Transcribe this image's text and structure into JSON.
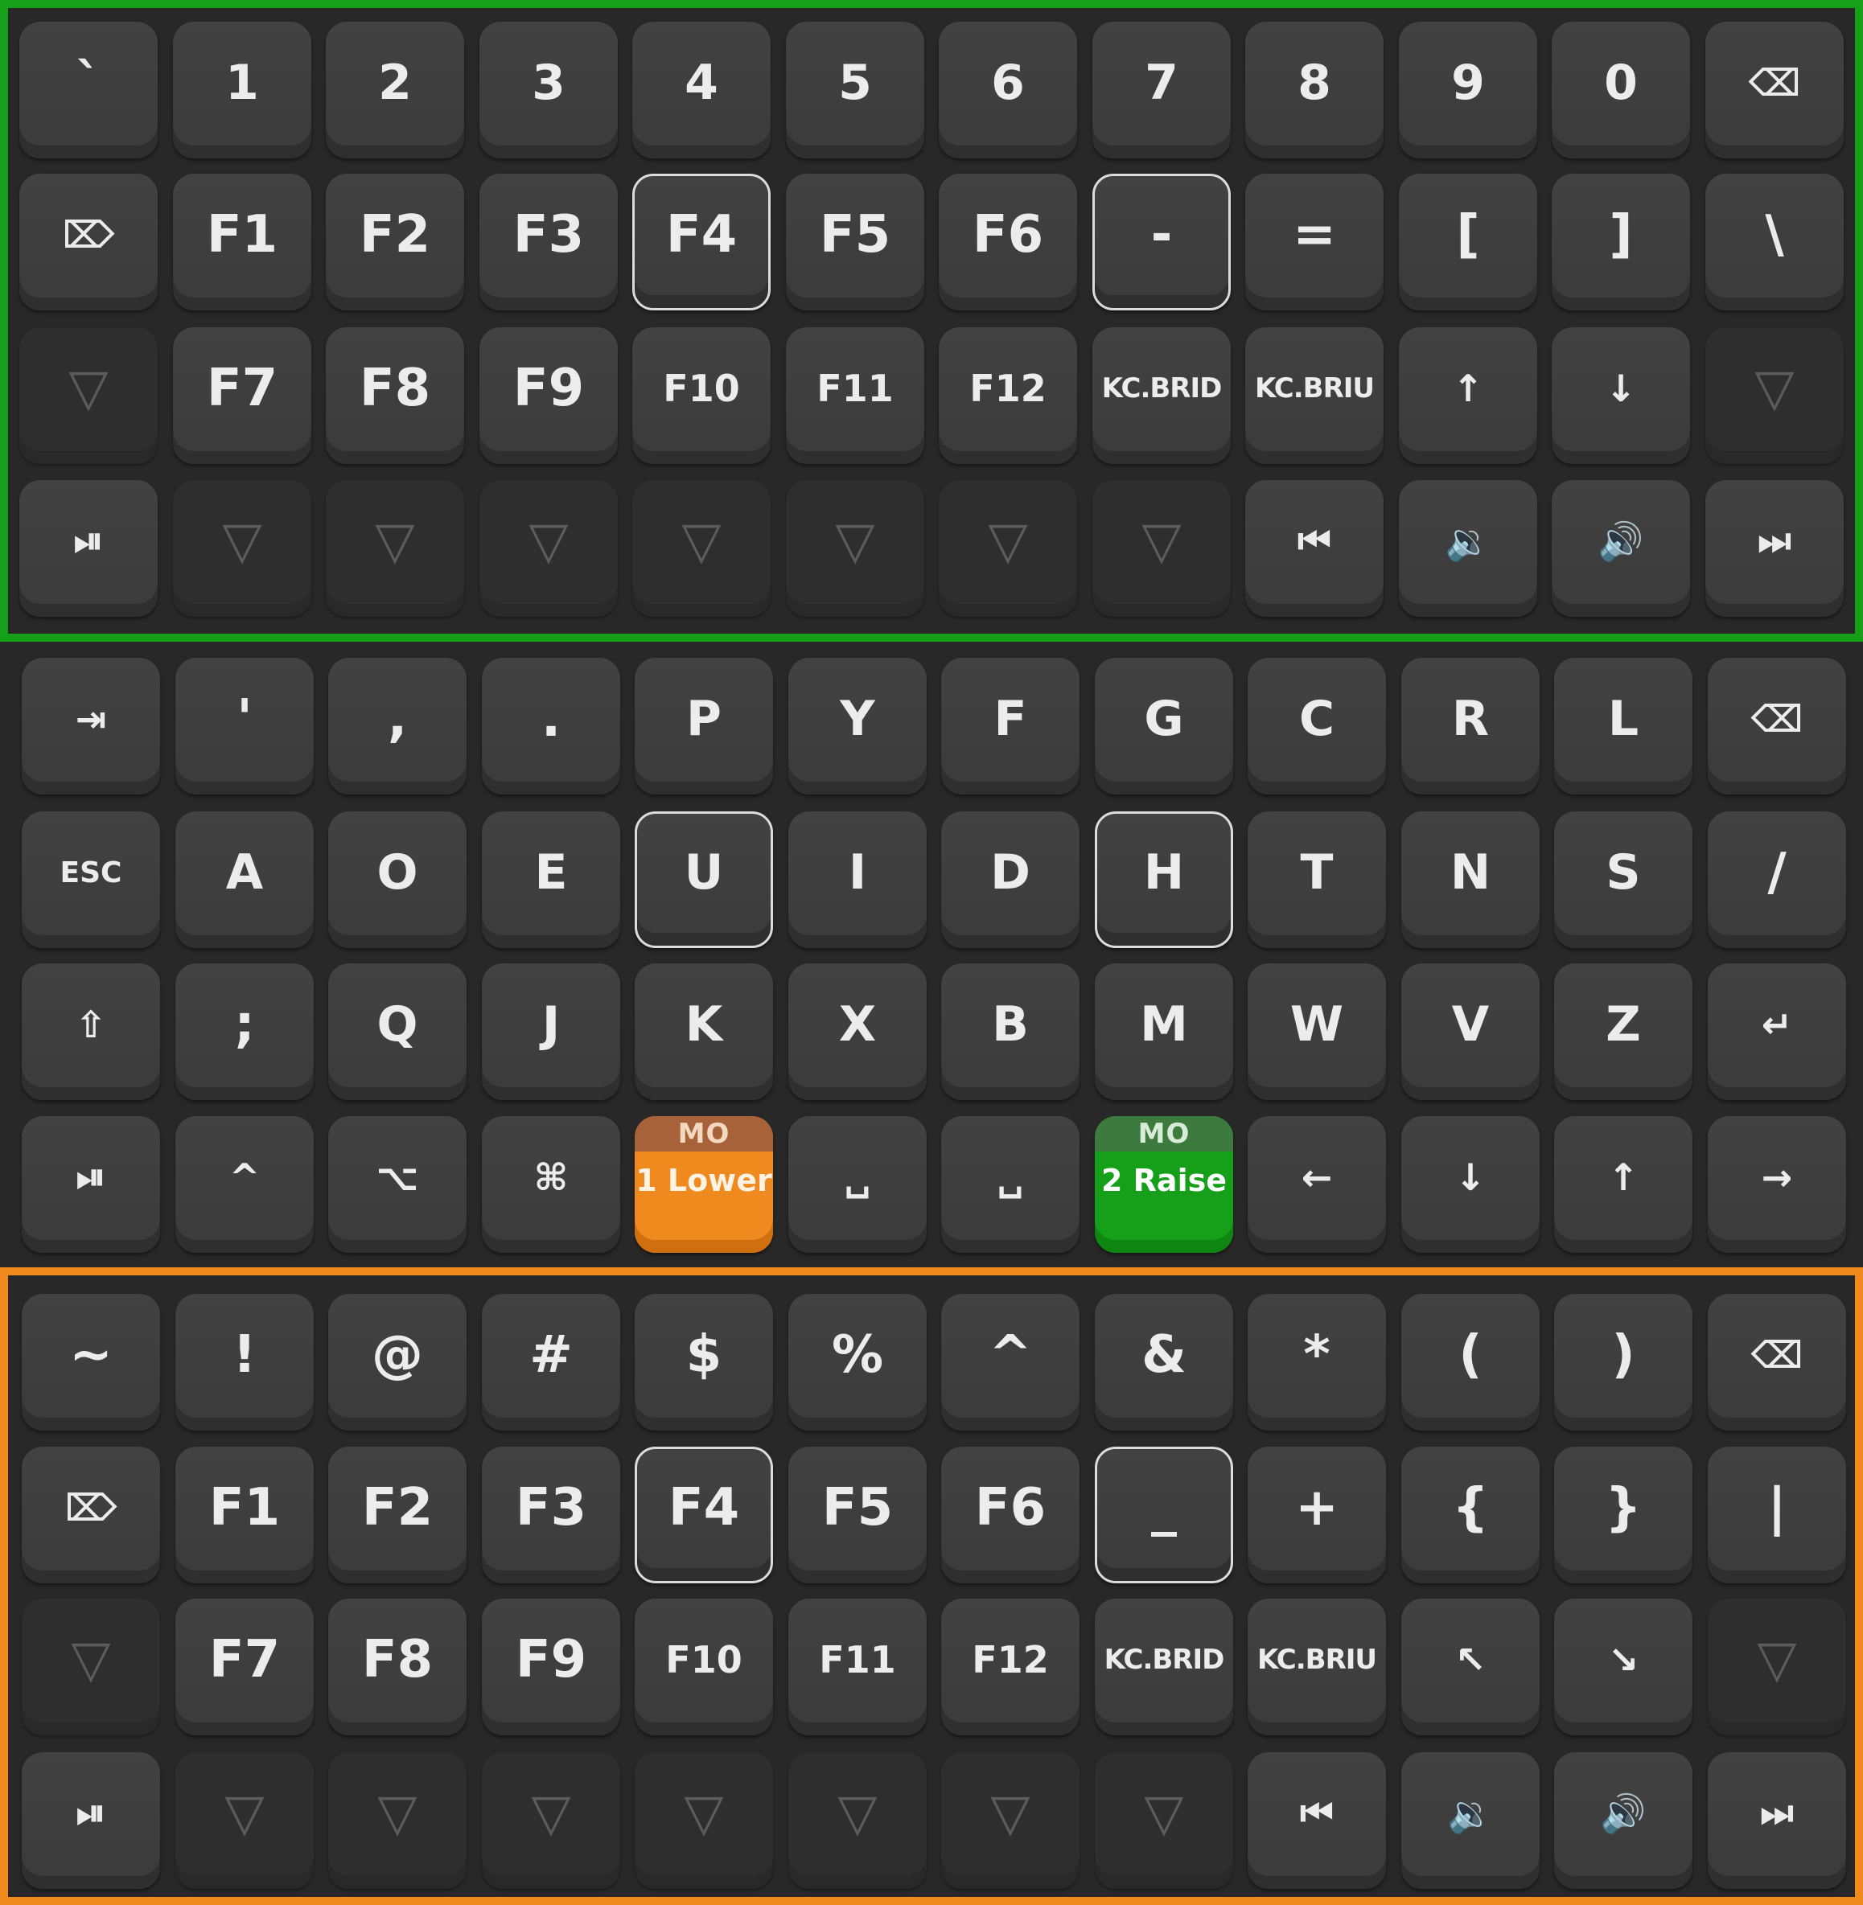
{
  "colors": {
    "background": "#282828",
    "key": "#3f3f3f",
    "key_transparent": "#2e2e2e",
    "lower_layer_accent": "#f08a1e",
    "raise_layer_accent": "#16a019",
    "held_outline": "#dcdcdc"
  },
  "layers": [
    {
      "id": "raise",
      "accent": "#16a019",
      "rows": [
        [
          {
            "label": "`"
          },
          {
            "label": "1"
          },
          {
            "label": "2"
          },
          {
            "label": "3"
          },
          {
            "label": "4"
          },
          {
            "label": "5"
          },
          {
            "label": "6"
          },
          {
            "label": "7"
          },
          {
            "label": "8"
          },
          {
            "label": "9"
          },
          {
            "label": "0"
          },
          {
            "label": "⌫",
            "icon": "backspace-icon"
          }
        ],
        [
          {
            "label": "⌦",
            "icon": "delete-icon"
          },
          {
            "label": "F1"
          },
          {
            "label": "F2"
          },
          {
            "label": "F3"
          },
          {
            "label": "F4",
            "held": true
          },
          {
            "label": "F5"
          },
          {
            "label": "F6"
          },
          {
            "label": "-",
            "held": true
          },
          {
            "label": "="
          },
          {
            "label": "["
          },
          {
            "label": "]"
          },
          {
            "label": "\\"
          }
        ],
        [
          {
            "label": "▽",
            "transparent": true
          },
          {
            "label": "F7"
          },
          {
            "label": "F8"
          },
          {
            "label": "F9"
          },
          {
            "label": "F10"
          },
          {
            "label": "F11"
          },
          {
            "label": "F12"
          },
          {
            "label": "KC.BRID"
          },
          {
            "label": "KC.BRIU"
          },
          {
            "label": "↑",
            "icon": "arrow-up-icon"
          },
          {
            "label": "↓",
            "icon": "arrow-down-icon"
          },
          {
            "label": "▽",
            "transparent": true
          }
        ],
        [
          {
            "label": "⏯",
            "icon": "play-pause-icon"
          },
          {
            "label": "▽",
            "transparent": true
          },
          {
            "label": "▽",
            "transparent": true
          },
          {
            "label": "▽",
            "transparent": true
          },
          {
            "label": "▽",
            "transparent": true
          },
          {
            "label": "▽",
            "transparent": true
          },
          {
            "label": "▽",
            "transparent": true
          },
          {
            "label": "▽",
            "transparent": true
          },
          {
            "label": "⏮",
            "icon": "previous-track-icon"
          },
          {
            "label": "🔉",
            "icon": "volume-down-icon"
          },
          {
            "label": "🔊",
            "icon": "volume-up-icon"
          },
          {
            "label": "⏭",
            "icon": "next-track-icon"
          }
        ]
      ]
    },
    {
      "id": "base",
      "accent": "",
      "rows": [
        [
          {
            "label": "⇥",
            "icon": "tab-icon"
          },
          {
            "label": "'"
          },
          {
            "label": ","
          },
          {
            "label": "."
          },
          {
            "label": "P"
          },
          {
            "label": "Y"
          },
          {
            "label": "F"
          },
          {
            "label": "G"
          },
          {
            "label": "C"
          },
          {
            "label": "R"
          },
          {
            "label": "L"
          },
          {
            "label": "⌫",
            "icon": "backspace-icon"
          }
        ],
        [
          {
            "label": "ESC"
          },
          {
            "label": "A"
          },
          {
            "label": "O"
          },
          {
            "label": "E"
          },
          {
            "label": "U",
            "held": true
          },
          {
            "label": "I"
          },
          {
            "label": "D"
          },
          {
            "label": "H",
            "held": true
          },
          {
            "label": "T"
          },
          {
            "label": "N"
          },
          {
            "label": "S"
          },
          {
            "label": "/"
          }
        ],
        [
          {
            "label": "⇧",
            "icon": "shift-icon"
          },
          {
            "label": ";"
          },
          {
            "label": "Q"
          },
          {
            "label": "J"
          },
          {
            "label": "K"
          },
          {
            "label": "X"
          },
          {
            "label": "B"
          },
          {
            "label": "M"
          },
          {
            "label": "W"
          },
          {
            "label": "V"
          },
          {
            "label": "Z"
          },
          {
            "label": "↵",
            "icon": "enter-icon"
          }
        ],
        [
          {
            "label": "⏯",
            "icon": "play-pause-icon"
          },
          {
            "label": "^",
            "icon": "control-icon"
          },
          {
            "label": "⌥",
            "icon": "option-icon"
          },
          {
            "label": "⌘",
            "icon": "command-icon"
          },
          {
            "label": "1 Lower",
            "mo": "MO",
            "mo_type": "lower"
          },
          {
            "label": "␣",
            "icon": "space-icon"
          },
          {
            "label": "␣",
            "icon": "space-icon"
          },
          {
            "label": "2 Raise",
            "mo": "MO",
            "mo_type": "raise"
          },
          {
            "label": "←",
            "icon": "arrow-left-icon"
          },
          {
            "label": "↓",
            "icon": "arrow-down-icon"
          },
          {
            "label": "↑",
            "icon": "arrow-up-icon"
          },
          {
            "label": "→",
            "icon": "arrow-right-icon"
          }
        ]
      ]
    },
    {
      "id": "lower",
      "accent": "#f08a1e",
      "rows": [
        [
          {
            "label": "~"
          },
          {
            "label": "!"
          },
          {
            "label": "@"
          },
          {
            "label": "#"
          },
          {
            "label": "$"
          },
          {
            "label": "%"
          },
          {
            "label": "^"
          },
          {
            "label": "&"
          },
          {
            "label": "*"
          },
          {
            "label": "("
          },
          {
            "label": ")"
          },
          {
            "label": "⌫",
            "icon": "backspace-icon"
          }
        ],
        [
          {
            "label": "⌦",
            "icon": "delete-icon"
          },
          {
            "label": "F1"
          },
          {
            "label": "F2"
          },
          {
            "label": "F3"
          },
          {
            "label": "F4",
            "held": true
          },
          {
            "label": "F5"
          },
          {
            "label": "F6"
          },
          {
            "label": "_",
            "held": true
          },
          {
            "label": "+"
          },
          {
            "label": "{"
          },
          {
            "label": "}"
          },
          {
            "label": "|"
          }
        ],
        [
          {
            "label": "▽",
            "transparent": true
          },
          {
            "label": "F7"
          },
          {
            "label": "F8"
          },
          {
            "label": "F9"
          },
          {
            "label": "F10"
          },
          {
            "label": "F11"
          },
          {
            "label": "F12"
          },
          {
            "label": "KC.BRID"
          },
          {
            "label": "KC.BRIU"
          },
          {
            "label": "↖",
            "icon": "home-icon"
          },
          {
            "label": "↘",
            "icon": "end-icon"
          },
          {
            "label": "▽",
            "transparent": true
          }
        ],
        [
          {
            "label": "⏯",
            "icon": "play-pause-icon"
          },
          {
            "label": "▽",
            "transparent": true
          },
          {
            "label": "▽",
            "transparent": true
          },
          {
            "label": "▽",
            "transparent": true
          },
          {
            "label": "▽",
            "transparent": true
          },
          {
            "label": "▽",
            "transparent": true
          },
          {
            "label": "▽",
            "transparent": true
          },
          {
            "label": "▽",
            "transparent": true
          },
          {
            "label": "⏮",
            "icon": "previous-track-icon"
          },
          {
            "label": "🔉",
            "icon": "volume-down-icon"
          },
          {
            "label": "🔊",
            "icon": "volume-up-icon"
          },
          {
            "label": "⏭",
            "icon": "next-track-icon"
          }
        ]
      ]
    }
  ]
}
